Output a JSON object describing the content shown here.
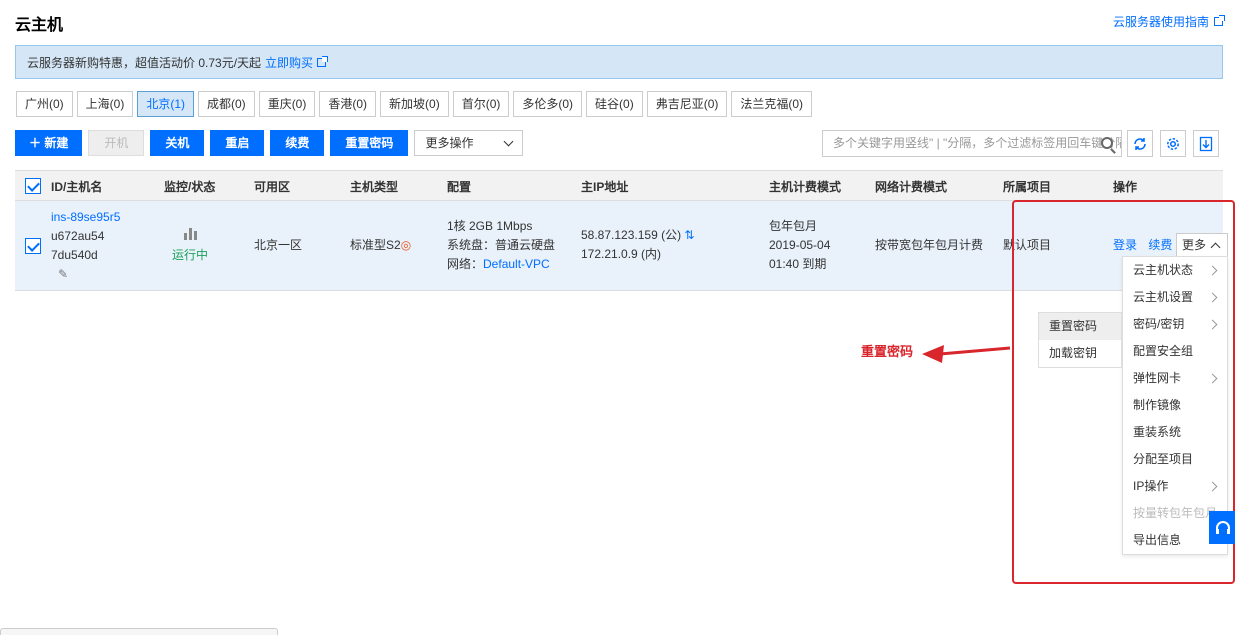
{
  "page": {
    "title": "云主机",
    "guide_link": "云服务器使用指南"
  },
  "promo": {
    "text": "云服务器新购特惠，超值活动价 0.73元/天起",
    "link": "立即购买"
  },
  "regions": [
    {
      "label": "广州(0)",
      "active": false
    },
    {
      "label": "上海(0)",
      "active": false
    },
    {
      "label": "北京(1)",
      "active": true
    },
    {
      "label": "成都(0)",
      "active": false
    },
    {
      "label": "重庆(0)",
      "active": false
    },
    {
      "label": "香港(0)",
      "active": false
    },
    {
      "label": "新加坡(0)",
      "active": false
    },
    {
      "label": "首尔(0)",
      "active": false
    },
    {
      "label": "多伦多(0)",
      "active": false
    },
    {
      "label": "硅谷(0)",
      "active": false
    },
    {
      "label": "弗吉尼亚(0)",
      "active": false
    },
    {
      "label": "法兰克福(0)",
      "active": false
    }
  ],
  "toolbar": {
    "new": "新建",
    "start": "开机",
    "shutdown": "关机",
    "restart": "重启",
    "renew": "续费",
    "reset_password": "重置密码",
    "more_actions": "更多操作"
  },
  "search": {
    "placeholder": "多个关键字用竖线\" | \"分隔，多个过滤标签用回车键分隔"
  },
  "table": {
    "headers": {
      "id": "ID/主机名",
      "monitor": "监控/状态",
      "zone": "可用区",
      "type": "主机类型",
      "config": "配置",
      "ip": "主IP地址",
      "billing": "主机计费模式",
      "network_billing": "网络计费模式",
      "project": "所属项目",
      "actions": "操作"
    },
    "row": {
      "id": "ins-89se95r5",
      "hostname_line1": "u672au54",
      "hostname_line2": "7du540d",
      "status": "运行中",
      "zone": "北京一区",
      "type": "标准型S2",
      "config_line1": "1核 2GB 1Mbps",
      "config_line2": "系统盘：普通云硬盘",
      "config_network_label": "网络：",
      "config_network": "Default-VPC",
      "ip_public": "58.87.123.159 (公)",
      "ip_private": "172.21.0.9 (内)",
      "billing_line1": "包年包月",
      "billing_line2": "2019-05-04",
      "billing_line3": "01:40 到期",
      "network_billing": "按带宽包年包月计费",
      "project": "默认项目",
      "action_login": "登录",
      "action_renew": "续费",
      "action_more": "更多"
    }
  },
  "more_menu": [
    {
      "label": "云主机状态",
      "submenu": true,
      "disabled": false
    },
    {
      "label": "云主机设置",
      "submenu": true,
      "disabled": false
    },
    {
      "label": "密码/密钥",
      "submenu": true,
      "disabled": false
    },
    {
      "label": "配置安全组",
      "submenu": false,
      "disabled": false
    },
    {
      "label": "弹性网卡",
      "submenu": true,
      "disabled": false
    },
    {
      "label": "制作镜像",
      "submenu": false,
      "disabled": false
    },
    {
      "label": "重装系统",
      "submenu": false,
      "disabled": false
    },
    {
      "label": "分配至项目",
      "submenu": false,
      "disabled": false
    },
    {
      "label": "IP操作",
      "submenu": true,
      "disabled": false
    },
    {
      "label": "按量转包年包月",
      "submenu": false,
      "disabled": true
    },
    {
      "label": "导出信息",
      "submenu": false,
      "disabled": false
    }
  ],
  "password_submenu": [
    {
      "label": "重置密码"
    },
    {
      "label": "加载密钥"
    }
  ],
  "annotation": {
    "text": "重置密码",
    "color": "#d9262c"
  },
  "colors": {
    "accent": "#006eff",
    "running": "#1ba159",
    "highlight": "#d9262c"
  }
}
